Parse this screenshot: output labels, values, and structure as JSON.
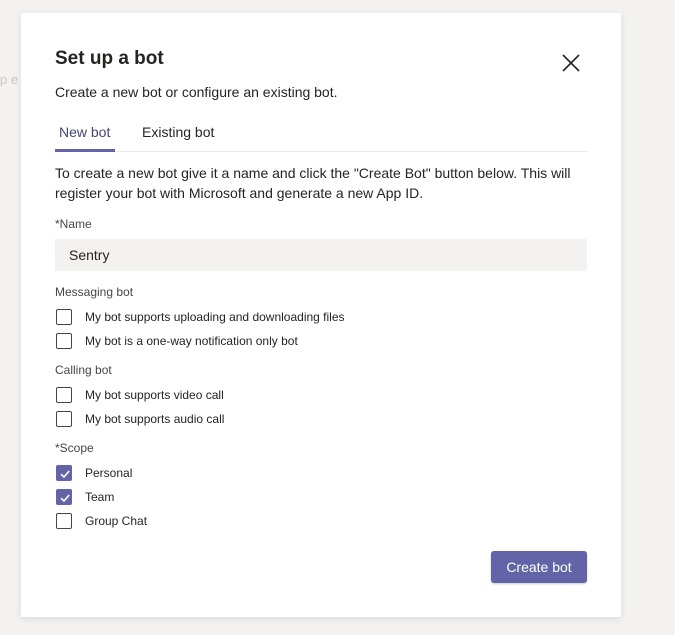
{
  "background": {
    "ghost_text": "p e"
  },
  "dialog": {
    "title": "Set up a bot",
    "subtitle": "Create a new bot or configure an existing bot.",
    "close_icon": "close-icon"
  },
  "tabs": [
    {
      "label": "New bot",
      "active": true
    },
    {
      "label": "Existing bot",
      "active": false
    }
  ],
  "description": "To create a new bot give it a name and click the \"Create Bot\" button below. This will register your bot with Microsoft and generate a new App ID.",
  "name_field": {
    "label": "*Name",
    "value": "Sentry"
  },
  "messaging_bot": {
    "label": "Messaging bot",
    "options": [
      {
        "label": "My bot supports uploading and downloading files",
        "checked": false
      },
      {
        "label": "My bot is a one-way notification only bot",
        "checked": false
      }
    ]
  },
  "calling_bot": {
    "label": "Calling bot",
    "options": [
      {
        "label": "My bot supports video call",
        "checked": false
      },
      {
        "label": "My bot supports audio call",
        "checked": false
      }
    ]
  },
  "scope": {
    "label": "*Scope",
    "options": [
      {
        "label": "Personal",
        "checked": true
      },
      {
        "label": "Team",
        "checked": true
      },
      {
        "label": "Group Chat",
        "checked": false
      }
    ]
  },
  "actions": {
    "create_label": "Create bot"
  },
  "colors": {
    "accent": "#6264a7",
    "active_tab_text": "#464775",
    "input_bg": "#f3f2f1"
  }
}
